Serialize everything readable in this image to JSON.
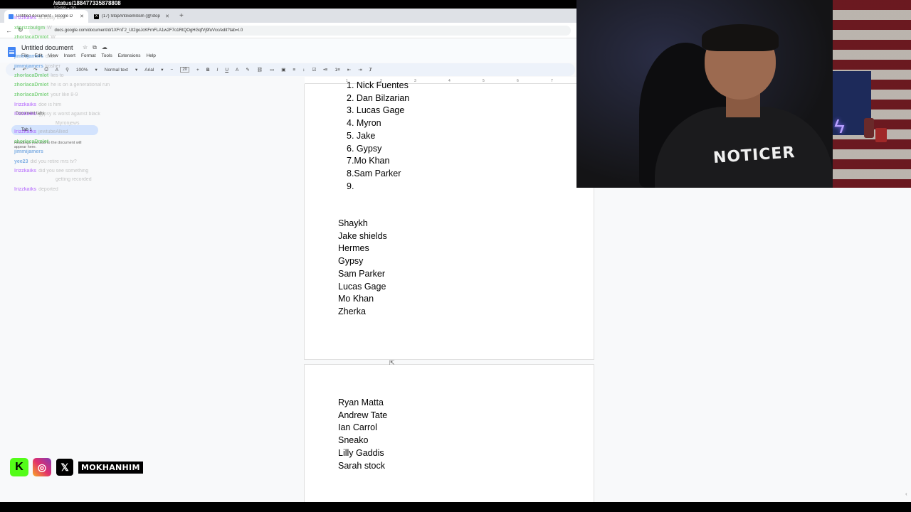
{
  "status_overlay": {
    "url_line": "/status/1884773358788​08",
    "sub_line": "12:58 ▪ 20"
  },
  "browser": {
    "tabs": [
      {
        "title": "Untitled document - Google D",
        "active": true
      },
      {
        "title": "(17) StopAntiSemitism (@Stop",
        "active": false
      }
    ],
    "new_tab": "+",
    "url": "docs.google.com/document/d/1XFnT2_Ut2goJcKFmFLA1w2F7o1RtQOgHGqfVj9fuVcc/edit?tab=t.0"
  },
  "docs": {
    "title": "Untitled document",
    "menu": [
      "File",
      "Edit",
      "View",
      "Insert",
      "Format",
      "Tools",
      "Extensions",
      "Help"
    ],
    "toolbar": {
      "zoom": "100%",
      "style": "Normal text",
      "font": "Arial",
      "size": "20"
    },
    "outline": {
      "label": "Document tabs",
      "tab_name": "Tab 1",
      "hint": "Headings you add to the document will appear here."
    }
  },
  "chat": [
    {
      "user": "lrizzkaiks",
      "msg": "actually kike",
      "color": "#9b30ff"
    },
    {
      "user": "xtgrizzbulgm",
      "msg": "W",
      "color": "#2eb82e"
    },
    {
      "user": "zhorlacaDmlot",
      "msg": "W",
      "color": "#2eb82e"
    },
    {
      "user": "jimmijamers",
      "msg": "dcdv",
      "color": "#1e73d2"
    },
    {
      "user": "jimmijamers",
      "msg": "kosher",
      "color": "#1e73d2"
    },
    {
      "user": "zhorlacaDmlot",
      "msg": "lies to",
      "color": "#2eb82e"
    },
    {
      "user": "zhorlacaDmlot",
      "msg": "he is on a generational run",
      "color": "#2eb82e"
    },
    {
      "user": "zhorlacaDmlot",
      "msg": "your like 8-9",
      "color": "#2eb82e"
    },
    {
      "user": "lrizzkaiks",
      "msg": "doe is him",
      "color": "#9b30ff"
    },
    {
      "user": "lrizzkaiks",
      "msg": "gypsy is worst against black",
      "color": "#9b30ff"
    },
    {
      "user": "",
      "msg": "Myronjews",
      "color": "#999999"
    },
    {
      "user": "lrizzkaiks",
      "msg": "jewtubeAllied",
      "color": "#9b30ff"
    },
    {
      "user": "zhorlacaDmlot",
      "msg": "",
      "color": "#2eb82e"
    },
    {
      "user": "jimmijamers",
      "msg": "",
      "color": "#1e73d2"
    },
    {
      "user": "yee23",
      "msg": "did you retire mrs tv?",
      "color": "#1e73d2"
    },
    {
      "user": "lrizzkaiks",
      "msg": "did you see something",
      "color": "#9b30ff"
    },
    {
      "user": "",
      "msg": "getting recorded",
      "color": "#999999"
    },
    {
      "user": "lrizzkaiks",
      "msg": "deported",
      "color": "#9b30ff"
    }
  ],
  "ruler_ticks": [
    "1",
    "2",
    "3",
    "4",
    "5",
    "6",
    "7"
  ],
  "page1": {
    "numbered": [
      "1. Nick Fuentes",
      "2. Dan Bilzarian",
      "3. Lucas Gage",
      "4. Myron",
      "5. Jake",
      "6. Gypsy",
      "7.Mo Khan",
      "8.Sam Parker",
      "9."
    ],
    "names": [
      "Shaykh",
      "Jake shields",
      "Hermes",
      "Gypsy",
      "Sam Parker",
      "Lucas Gage",
      "Mo Khan",
      "Zherka"
    ]
  },
  "page2": {
    "names": [
      "Ryan Matta",
      "Andrew Tate",
      "Ian Carrol",
      "Sneako",
      "Lilly Gaddis",
      "Sarah stock"
    ]
  },
  "webcam": {
    "shirt_text": "NOTICER"
  },
  "social": {
    "kick": "K",
    "instagram": "◎",
    "x": "𝕏",
    "handle": "MOKHANHIM"
  }
}
